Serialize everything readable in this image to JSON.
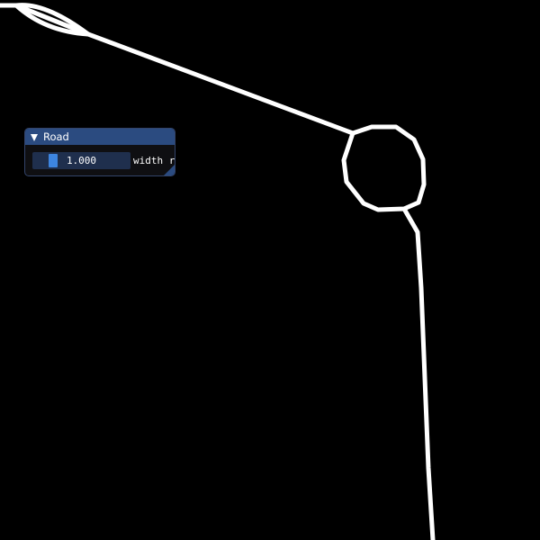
{
  "window": {
    "title": "Road",
    "slider": {
      "value_text": "1.000",
      "label": "width r"
    }
  },
  "colors": {
    "background": "#000000",
    "road": "#ffffff",
    "title_bar": "#2b4b80",
    "slider_frame": "#1f2f4d",
    "slider_grab": "#3d85e0"
  },
  "icons": {
    "collapse": "triangle-down-icon",
    "resize": "resize-grip-icon"
  }
}
